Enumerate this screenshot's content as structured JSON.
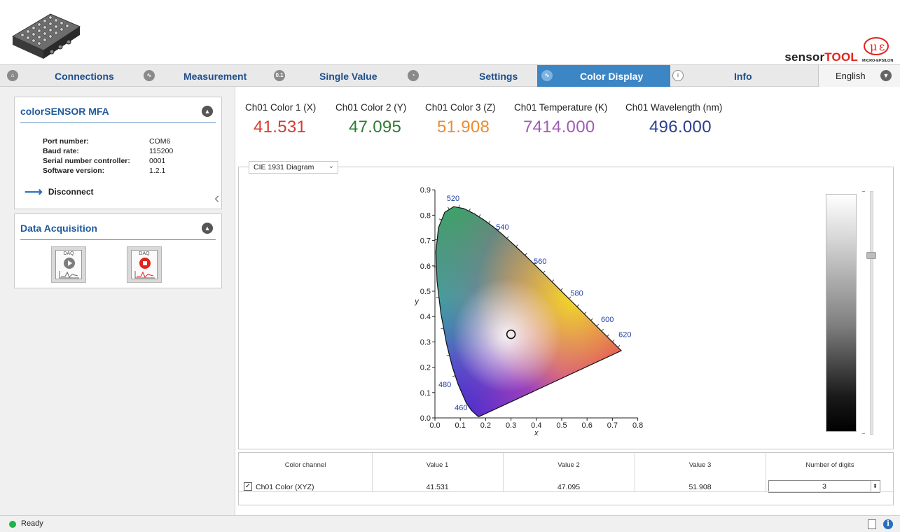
{
  "header": {
    "brand_prefix": "sensor",
    "brand_suffix": "TOOL",
    "logo_text": "MICRO-EPSILON"
  },
  "tabs": [
    {
      "label": "Connections",
      "icon": "home-icon",
      "active": false
    },
    {
      "label": "Measurement",
      "icon": "waveform-icon",
      "active": false
    },
    {
      "label": "Single Value",
      "icon": "single-value-icon",
      "glyph": "0.1",
      "active": false
    },
    {
      "label": "Settings",
      "icon": "settings-icon",
      "active": false
    },
    {
      "label": "Color Display",
      "icon": "waveform-icon",
      "active": true
    },
    {
      "label": "Info",
      "icon": "info-icon",
      "active": false
    }
  ],
  "language": {
    "selected": "English"
  },
  "sensor_panel": {
    "title": "colorSENSOR MFA",
    "fields": [
      {
        "key": "Port number:",
        "value": "COM6"
      },
      {
        "key": "Baud rate:",
        "value": "115200"
      },
      {
        "key": "Serial number controller:",
        "value": "0001"
      },
      {
        "key": "Software version:",
        "value": "1.2.1"
      }
    ],
    "disconnect_label": "Disconnect"
  },
  "daq_panel": {
    "title": "Data Acquisition",
    "start_label": "DAQ",
    "stop_label": "DAQ"
  },
  "readouts": [
    {
      "label": "Ch01 Color 1 (X)",
      "value": "41.531",
      "color": "#d63a2f"
    },
    {
      "label": "Ch01 Color 2 (Y)",
      "value": "47.095",
      "color": "#2e7d32"
    },
    {
      "label": "Ch01 Color 3 (Z)",
      "value": "51.908",
      "color": "#f08a2c"
    },
    {
      "label": "Ch01 Temperature (K)",
      "value": "7414.000",
      "color": "#a05cb5"
    },
    {
      "label": "Ch01 Wavelength (nm)",
      "value": "496.000",
      "color": "#2d3f8e"
    }
  ],
  "diagram": {
    "selector": "CIE 1931 Diagram",
    "xlabel": "x",
    "ylabel": "y",
    "x_ticks": [
      "0.0",
      "0.1",
      "0.2",
      "0.3",
      "0.4",
      "0.5",
      "0.6",
      "0.7",
      "0.8"
    ],
    "y_ticks": [
      "0.0",
      "0.1",
      "0.2",
      "0.3",
      "0.4",
      "0.5",
      "0.6",
      "0.7",
      "0.8",
      "0.9"
    ],
    "wavelength_labels": [
      "460",
      "480",
      "520",
      "540",
      "560",
      "580",
      "600",
      "620"
    ],
    "marker": {
      "x": 0.3,
      "y": 0.33
    }
  },
  "table": {
    "headers": [
      "Color channel",
      "Value 1",
      "Value 2",
      "Value 3",
      "Number of digits"
    ],
    "row": {
      "channel": "Ch01 Color (XYZ)",
      "checked": true,
      "v1": "41.531",
      "v2": "47.095",
      "v3": "51.908",
      "digits": "3"
    }
  },
  "status": {
    "text": "Ready"
  }
}
